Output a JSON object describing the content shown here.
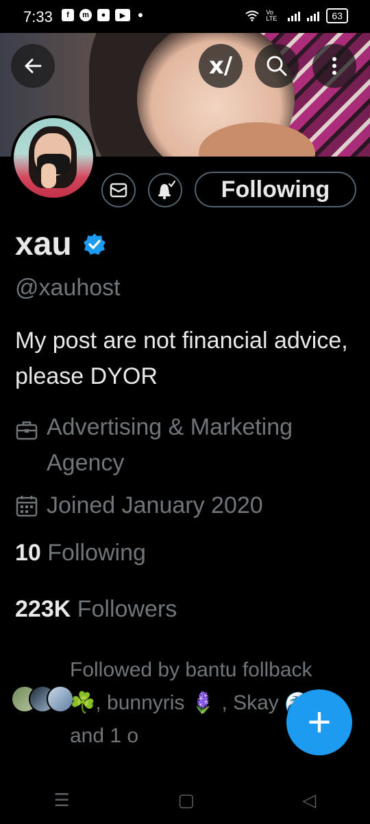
{
  "status_bar": {
    "time": "7:33",
    "network_label": "Vo LTE",
    "battery": "63"
  },
  "header": {
    "back_icon": "arrow-left-icon",
    "grok_icon": "grok-icon",
    "grok_glyph": "x/",
    "search_icon": "search-icon",
    "more_icon": "more-vertical-icon"
  },
  "profile": {
    "name": "xau",
    "handle": "@xauhost",
    "bio": "My post are not financial advice, please DYOR",
    "category": "Advertising & Marketing Agency",
    "joined": "Joined January 2020",
    "following_count": "10",
    "following_label": "Following",
    "followers_count": "223K",
    "followers_label": "Followers",
    "followed_by": "Followed by bantu follback☘️, bunnyris 🪻 , Skay 🌊, and 1 o",
    "verified_color": "#1d9bf0"
  },
  "actions": {
    "message_icon": "envelope-icon",
    "notify_icon": "bell-check-icon",
    "following_button": "Following"
  },
  "fab": {
    "icon": "plus-icon",
    "glyph": "+"
  },
  "nav": {
    "menu_glyph": "☰",
    "home_glyph": "▢",
    "back_glyph": "◁"
  },
  "colors": {
    "accent": "#1d9bf0",
    "muted": "#71767b",
    "text": "#e7e9ea",
    "border": "#536471"
  }
}
